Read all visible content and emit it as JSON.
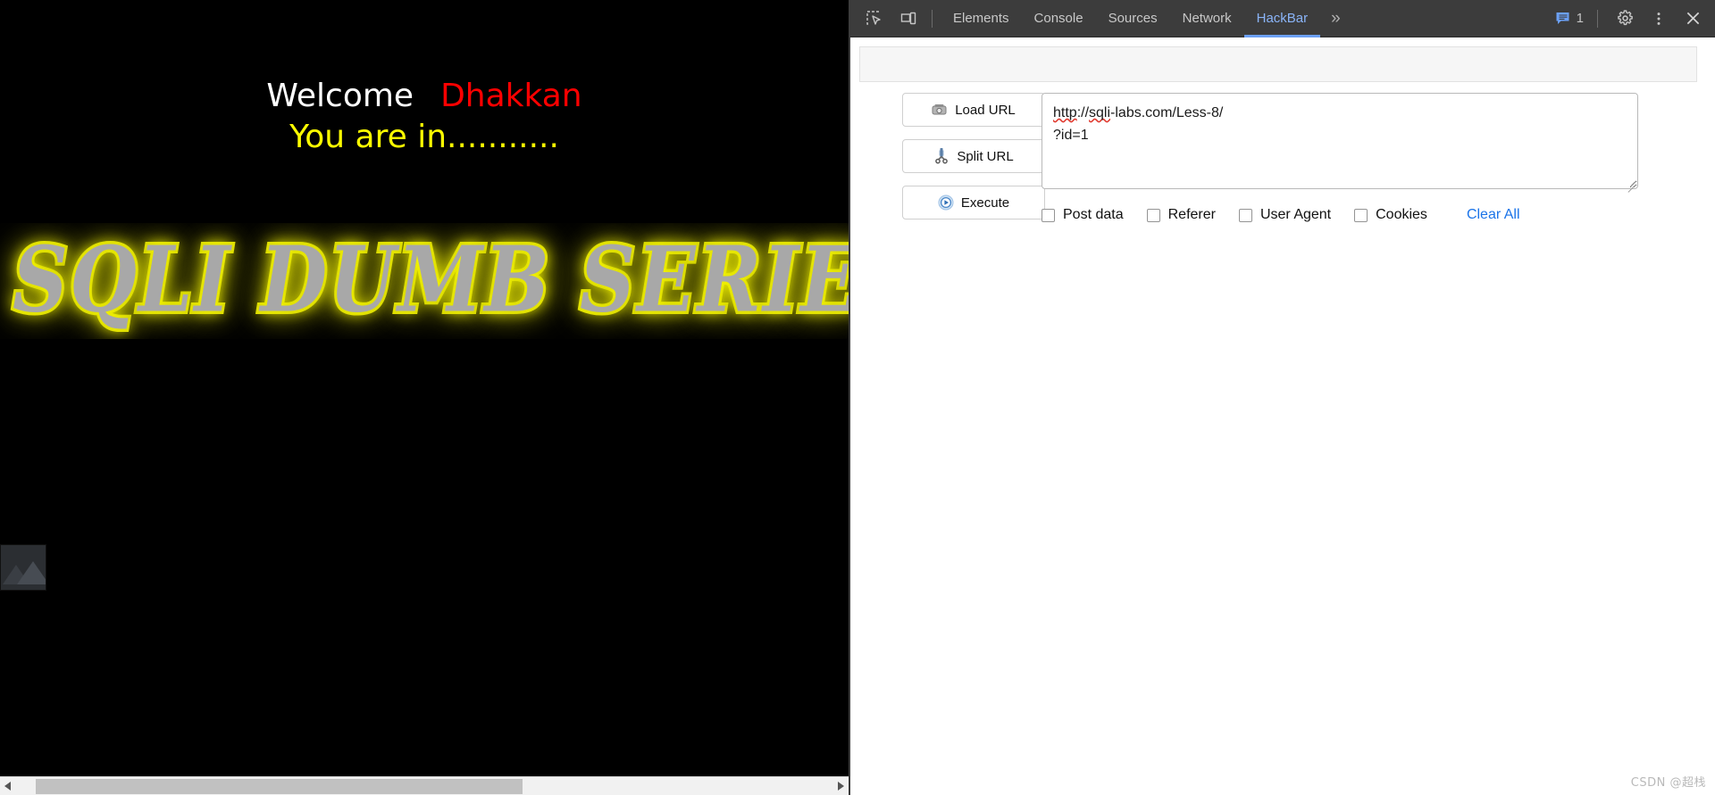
{
  "page": {
    "welcome_word": "Welcome",
    "welcome_name": "Dhakkan",
    "status_line": "You are in...........",
    "banner_text": "SQLI DUMB SERIES",
    "broken_image_name": "broken-image-placeholder",
    "colors": {
      "background": "#000000",
      "welcome": "#ffffff",
      "name": "#ff0000",
      "status": "#ffff00",
      "banner_glow": "#ffff00",
      "banner_fill": "#a8a8a8"
    }
  },
  "devtools": {
    "tabs": [
      {
        "label": "Elements",
        "active": false
      },
      {
        "label": "Console",
        "active": false
      },
      {
        "label": "Sources",
        "active": false
      },
      {
        "label": "Network",
        "active": false
      },
      {
        "label": "HackBar",
        "active": true
      }
    ],
    "more_tabs_label": "»",
    "message_count": "1",
    "icons": {
      "inspect": "inspect-element-icon",
      "device": "device-toolbar-icon",
      "messages": "console-message-icon",
      "settings": "gear-icon",
      "menu": "kebab-menu-icon",
      "close": "close-icon"
    },
    "accent_color": "#8ab4f8",
    "header_background": "#3c3c3c"
  },
  "hackbar": {
    "buttons": [
      {
        "label": "Load URL",
        "icon": "load-url-icon"
      },
      {
        "label": "Split URL",
        "icon": "split-url-icon"
      },
      {
        "label": "Execute",
        "icon": "execute-icon"
      }
    ],
    "url_field": {
      "value": "http://sqli-labs.com/Less-8/?id=1",
      "line1_misspelled_a": "http",
      "line1_sep": "://",
      "line1_misspelled_b": "sqli",
      "line1_rest": "-labs.com/Less-8/",
      "line2": "?id=1",
      "placeholder": ""
    },
    "options": [
      {
        "label": "Post data",
        "checked": false
      },
      {
        "label": "Referer",
        "checked": false
      },
      {
        "label": "User Agent",
        "checked": false
      },
      {
        "label": "Cookies",
        "checked": false
      }
    ],
    "clear_all_label": "Clear All",
    "clear_all_color": "#1a73e8"
  },
  "scrollbar": {
    "left_arrow": "scroll-left-arrow",
    "right_arrow": "scroll-right-arrow"
  },
  "watermark": {
    "text": "CSDN @超栈"
  }
}
